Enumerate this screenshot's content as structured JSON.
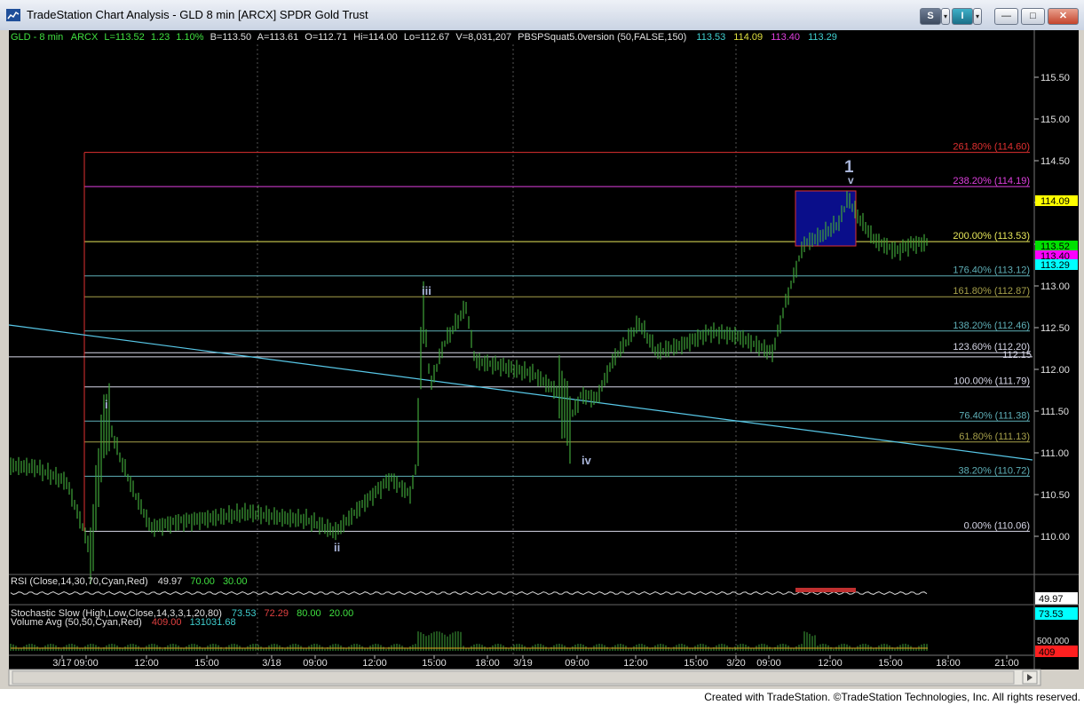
{
  "window": {
    "title": "TradeStation Chart Analysis - GLD 8 min [ARCX] SPDR Gold Trust",
    "btn_s": "S",
    "btn_i": "I",
    "dropdown_glyph": "▾",
    "minimize_glyph": "—",
    "maximize_glyph": "□",
    "close_glyph": "✕"
  },
  "colors": {
    "background": "#000000",
    "price_bars": "#3fa43a",
    "fib_red": "#e03030",
    "fib_magenta": "#e040e0",
    "fib_yellow": "#e8e85a",
    "fib_olive": "#a6a04a",
    "fib_teal": "#5fb0b8",
    "fib_white": "#d8d8e8",
    "trendline": "#58c8e8",
    "wave_label": "#a8b4d8",
    "highlight_box": "#0a0e8a"
  },
  "status": {
    "symbol": "GLD - 8 min",
    "exchange": "ARCX",
    "last": "L=113.52",
    "change": "1.23",
    "change_pct": "1.10%",
    "bid": "B=113.50",
    "ask": "A=113.61",
    "open": "O=112.71",
    "high": "Hi=114.00",
    "low": "Lo=112.67",
    "volume": "V=8,031,207",
    "indicator": "PBSPSquat5.0version (50,FALSE,150)",
    "v1": "113.53",
    "v2": "114.09",
    "v3": "113.40",
    "v4": "113.29"
  },
  "rsi": {
    "label": "RSI (Close,14,30,70,Cyan,Red)",
    "value": "49.97",
    "overbought": "70.00",
    "oversold": "30.00",
    "axis_value": "49.97"
  },
  "stoch": {
    "label": "Stochastic Slow (High,Low,Close,14,3,3,1,20,80)",
    "k": "73.53",
    "d": "72.29",
    "upper": "80.00",
    "lower": "20.00",
    "axis_value": "73.53"
  },
  "volume": {
    "label": "Volume Avg (50,50,Cyan,Red)",
    "value": "409.00",
    "avg": "131031.68",
    "axis_tick": "500,000",
    "axis_value": "409"
  },
  "axis_price": {
    "ticks": [
      "115.50",
      "115.00",
      "114.50",
      "114.00",
      "113.50",
      "113.00",
      "112.50",
      "112.00",
      "111.50",
      "111.00",
      "110.50",
      "110.00"
    ],
    "markers": [
      {
        "text": "114.09",
        "bg": "#ffff00",
        "fg": "#000000"
      },
      {
        "text": "113.52",
        "bg": "#00e000",
        "fg": "#000000"
      },
      {
        "text": "113.40",
        "bg": "#ff00ff",
        "fg": "#000000"
      },
      {
        "text": "113.29",
        "bg": "#00ffff",
        "fg": "#000000"
      }
    ]
  },
  "fib_levels": [
    {
      "label": "261.80% (114.60)",
      "price": 114.6,
      "color": "#e03030"
    },
    {
      "label": "238.20% (114.19)",
      "price": 114.19,
      "color": "#e040e0"
    },
    {
      "label": "200.00% (113.53)",
      "price": 113.53,
      "color": "#e8e85a"
    },
    {
      "label": "176.40% (113.12)",
      "price": 113.12,
      "color": "#5fb0b8"
    },
    {
      "label": "161.80% (112.87)",
      "price": 112.87,
      "color": "#a6a04a"
    },
    {
      "label": "138.20% (112.46)",
      "price": 112.46,
      "color": "#5fb0b8"
    },
    {
      "label": "123.60% (112.20)",
      "price": 112.2,
      "color": "#d8d8e8"
    },
    {
      "label": "100.00% (111.79)",
      "price": 111.79,
      "color": "#d8d8e8"
    },
    {
      "label": "76.40% (111.38)",
      "price": 111.38,
      "color": "#5fb0b8"
    },
    {
      "label": "61.80% (111.13)",
      "price": 111.13,
      "color": "#a6a04a"
    },
    {
      "label": "38.20% (110.72)",
      "price": 110.72,
      "color": "#5fb0b8"
    },
    {
      "label": "0.00% (110.06)",
      "price": 110.06,
      "color": "#d8d8e8"
    }
  ],
  "horizontal_line": {
    "label": "112.15",
    "price": 112.15
  },
  "wave_labels": [
    "i",
    "ii",
    "iii",
    "iv",
    "1",
    "v"
  ],
  "x_axis": [
    "3/17",
    "09:00",
    "12:00",
    "15:00",
    "3/18",
    "09:00",
    "12:00",
    "15:00",
    "18:00",
    "3/19",
    "09:00",
    "12:00",
    "15:00",
    "3/20",
    "09:00",
    "12:00",
    "15:00",
    "18:00",
    "21:00"
  ],
  "footer": {
    "credit": "Created with TradeStation. ©TradeStation Technologies, Inc. All rights reserved."
  }
}
